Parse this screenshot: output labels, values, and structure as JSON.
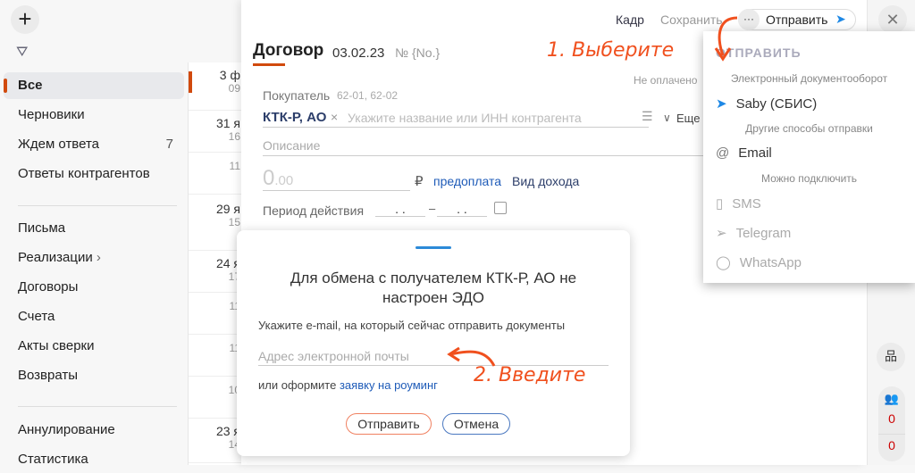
{
  "sidebar": {
    "items": [
      {
        "label": "Все"
      },
      {
        "label": "Черновики"
      },
      {
        "label": "Ждем ответа",
        "count": "7"
      },
      {
        "label": "Ответы контрагентов"
      },
      {
        "label": "Письма"
      },
      {
        "label": "Реализации"
      },
      {
        "label": "Договоры"
      },
      {
        "label": "Счета"
      },
      {
        "label": "Акты сверки"
      },
      {
        "label": "Возвраты"
      },
      {
        "label": "Аннулирование"
      },
      {
        "label": "Статистика"
      }
    ]
  },
  "list": [
    {
      "date": "3 ф",
      "time": "09"
    },
    {
      "date": "31 я",
      "time": "16"
    },
    {
      "date": "",
      "time": "11"
    },
    {
      "date": "29 я",
      "time": "15"
    },
    {
      "date": "24 я",
      "time": "17"
    },
    {
      "date": "",
      "time": "11"
    },
    {
      "date": "",
      "time": "11"
    },
    {
      "date": "",
      "time": "10"
    },
    {
      "date": "23 я",
      "time": "14"
    }
  ],
  "toolbar": {
    "frame": "Кадр",
    "save": "Сохранить",
    "more": "···",
    "send": "Отправить"
  },
  "doc": {
    "title": "Договор",
    "date": "03.02.23",
    "number_label": "№",
    "number": "{No.}",
    "status": "Не оплачено",
    "buyer_label": "Покупатель",
    "buyer_codes": "62-01, 62-02",
    "buyer": "КТК-Р, АО",
    "buyer_placeholder": "Укажите название или ИНН контрагента",
    "more": "Еще",
    "description": "Описание",
    "amount_int": "0",
    "amount_dec": ".00",
    "currency": "₽",
    "prepay": "предоплата",
    "income_type": "Вид дохода",
    "period_label": "Период действия",
    "date_mask": ". .",
    "dash": "–"
  },
  "dialog": {
    "title": "Для обмена с получателем КТК-Р, АО не настроен ЭДО",
    "hint": "Укажите e-mail, на который сейчас отправить документы",
    "email_placeholder": "Адрес электронной почты",
    "or_text": "или оформите",
    "roaming_link": "заявку на роуминг",
    "send": "Отправить",
    "cancel": "Отмена"
  },
  "dropdown": {
    "title": "ОТПРАВИТЬ",
    "group_edo": "Электронный документооборот",
    "saby": "Saby (СБИС)",
    "group_other": "Другие способы отправки",
    "email": "Email",
    "group_connect": "Можно подключить",
    "sms": "SMS",
    "telegram": "Telegram",
    "whatsapp": "WhatsApp"
  },
  "annotations": {
    "step1": "1. Выберите",
    "step2": "2. Введите"
  },
  "rstrip": {
    "count1": "0",
    "count2": "0"
  },
  "colors": {
    "accent": "#d14a0d",
    "annotation": "#f0501e",
    "link": "#1e5bb8",
    "saby": "#1e88e5"
  }
}
